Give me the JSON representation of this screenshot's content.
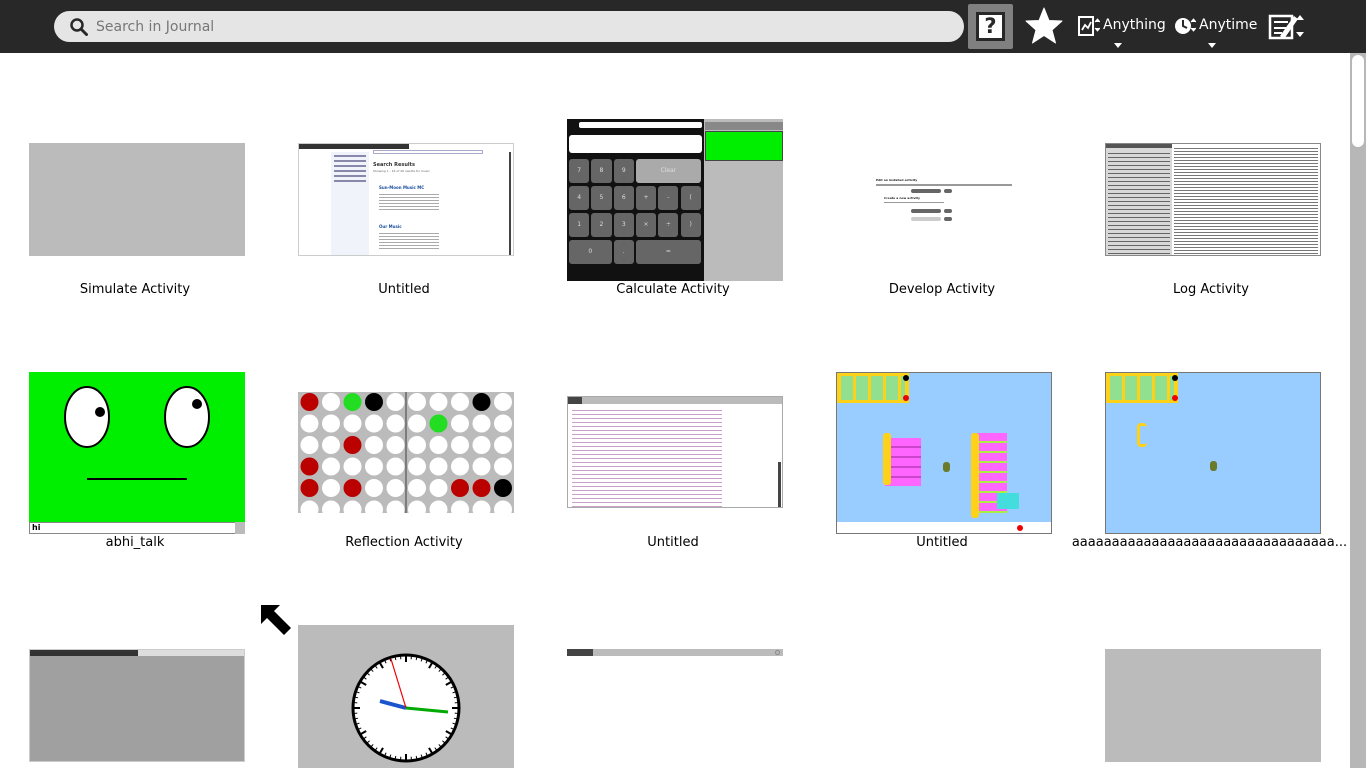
{
  "toolbar": {
    "search_placeholder": "Search in Journal",
    "help_label": "?",
    "filter_type_label": "Anything",
    "filter_time_label": "Anytime"
  },
  "entries": [
    {
      "title": "Simulate Activity"
    },
    {
      "title": "Untitled"
    },
    {
      "title": "Calculate Activity"
    },
    {
      "title": "Develop Activity"
    },
    {
      "title": "Log Activity"
    },
    {
      "title": "abhi_talk",
      "text_field": "hi"
    },
    {
      "title": "Reflection Activity"
    },
    {
      "title": "Untitled"
    },
    {
      "title": "Untitled"
    },
    {
      "title": "aaaaaaaaaaaaaaaaaaaaaaaaaaaaaaaaa..."
    }
  ],
  "thumbnails": {
    "search_results": {
      "heading": "Search Results",
      "subheading": "Showing 1 - 16 of 26 results for music",
      "result_1": "Sun-Moon Music MC",
      "result_2": "Our Music"
    },
    "calculate": {
      "keys": [
        "7",
        "8",
        "9",
        "Clear",
        "4",
        "5",
        "6",
        "+",
        "-",
        "(",
        "1",
        "2",
        "3",
        "×",
        "÷",
        ")",
        "0",
        ".",
        "="
      ]
    },
    "develop": {
      "line_1": "Edit an installed activity",
      "line_2": "Create a new activity"
    }
  },
  "colors": {
    "toolbar": "#282828",
    "accent_green": "#00ee00",
    "thumb_gray": "#bbbbbb",
    "turtle_blue": "#99ccff"
  }
}
